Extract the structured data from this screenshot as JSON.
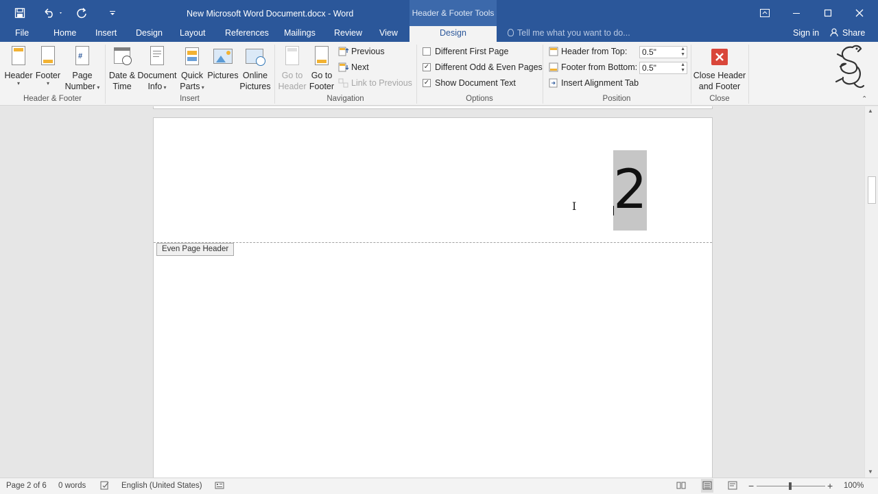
{
  "title_bar": {
    "doc_title": "New Microsoft Word Document.docx - Word",
    "context_tab_header": "Header & Footer Tools"
  },
  "tabs": {
    "file": "File",
    "home": "Home",
    "insert": "Insert",
    "design": "Design",
    "layout": "Layout",
    "references": "References",
    "mailings": "Mailings",
    "review": "Review",
    "view": "View",
    "design_active": "Design",
    "tell_me": "Tell me what you want to do...",
    "sign_in": "Sign in",
    "share": "Share"
  },
  "ribbon": {
    "header_footer": {
      "header_label": "Header",
      "footer_label": "Footer",
      "page_number_line1": "Page",
      "page_number_line2": "Number",
      "group_label": "Header & Footer"
    },
    "insert": {
      "date_time_line1": "Date &",
      "date_time_line2": "Time",
      "doc_info_line1": "Document",
      "doc_info_line2": "Info",
      "quick_parts_line1": "Quick",
      "quick_parts_line2": "Parts",
      "pictures": "Pictures",
      "online_pictures_line1": "Online",
      "online_pictures_line2": "Pictures",
      "group_label": "Insert"
    },
    "navigation": {
      "goto_header_line1": "Go to",
      "goto_header_line2": "Header",
      "goto_footer_line1": "Go to",
      "goto_footer_line2": "Footer",
      "previous": "Previous",
      "next": "Next",
      "link_to_previous": "Link to Previous",
      "group_label": "Navigation"
    },
    "options": {
      "different_first_page": "Different First Page",
      "different_odd_even": "Different Odd & Even Pages",
      "show_document_text": "Show Document Text",
      "group_label": "Options",
      "checks": {
        "different_first_page": false,
        "different_odd_even": true,
        "show_document_text": true
      }
    },
    "position": {
      "header_from_top_label": "Header from Top:",
      "header_from_top_value": "0.5\"",
      "footer_from_bottom_label": "Footer from Bottom:",
      "footer_from_bottom_value": "0.5\"",
      "insert_alignment_tab": "Insert Alignment Tab",
      "group_label": "Position"
    },
    "close": {
      "close_line1": "Close Header",
      "close_line2": "and Footer",
      "group_label": "Close"
    }
  },
  "document": {
    "header_page_number": "2",
    "header_tag": "Even Page Header"
  },
  "status_bar": {
    "page": "Page 2 of 6",
    "words": "0 words",
    "language": "English (United States)",
    "zoom": "100%"
  },
  "colors": {
    "title_blue": "#2b579a",
    "close_red": "#d9463a",
    "ribbon_bg": "#f3f3f3"
  }
}
